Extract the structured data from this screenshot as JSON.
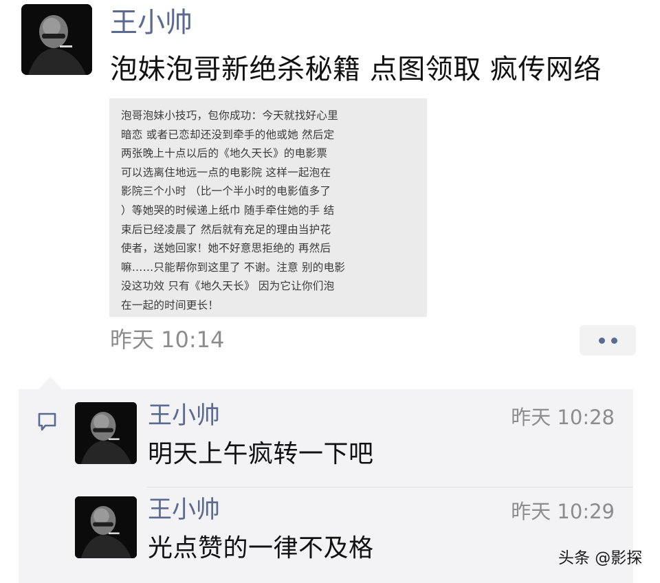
{
  "post": {
    "avatar_icon": "bald-man-portrait-avatar",
    "author": "王小帅",
    "text": "泡妹泡哥新绝杀秘籍 点图领取 疯传网络",
    "image_text_lines": [
      "泡哥泡妹小技巧，包你成功：今天就找好心里",
      "暗恋 或者已恋却还没到牵手的他或她 然后定",
      "两张晚上十点以后的《地久天长》的电影票",
      "可以选离住地远一点的电影院 这样一起泡在",
      "影院三个小时 （比一个半小时的电影值多了",
      "）等她哭的时候递上纸巾 随手牵住她的手 结",
      "束后已经凌晨了 然后就有充足的理由当护花",
      "使者，送她回家！她不好意思拒绝的 再然后",
      "嘛……只能帮你到这里了 不谢。注意 别的电影",
      "没这功效 只有《地久天长》 因为它让你们泡",
      "在一起的时间更长！"
    ],
    "time": "昨天 10:14",
    "more_icon": "more-dots-icon"
  },
  "comments": [
    {
      "author": "王小帅",
      "time": "昨天 10:28",
      "text": "明天上午疯转一下吧"
    },
    {
      "author": "王小帅",
      "time": "昨天 10:29",
      "text": "光点赞的一律不及格"
    }
  ],
  "comment_icon": "comment-bubble-icon",
  "watermark": "头条 @影探",
  "colors": {
    "name_blue": "#5b6a91",
    "text_dark": "#111111",
    "time_gray": "#8c8c8c",
    "comment_bg": "#f3f3f5",
    "card_bg": "#ebebeb"
  }
}
